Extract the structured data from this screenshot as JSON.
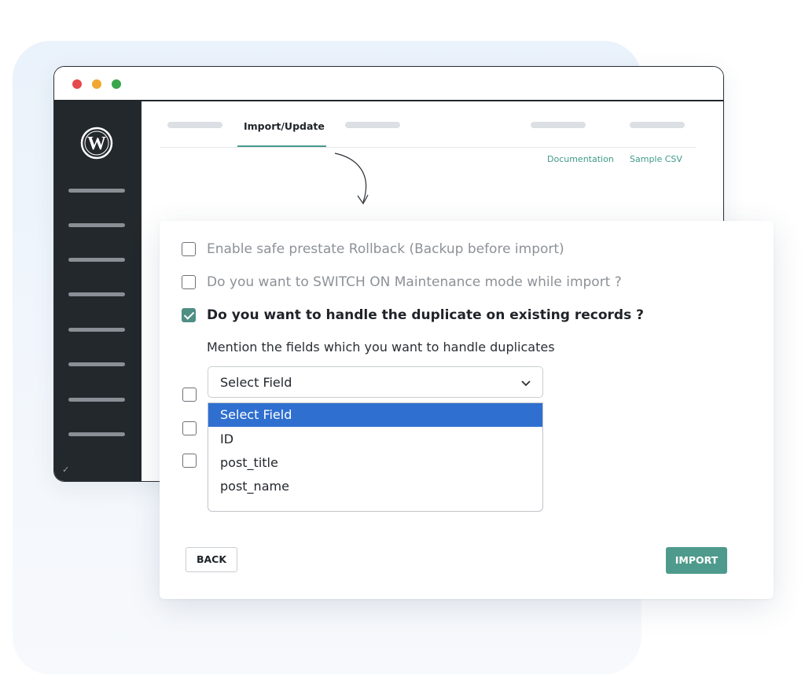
{
  "browser": {
    "top_tabs": {
      "active_label": "Import/Update"
    },
    "links": {
      "documentation": "Documentation",
      "sample_csv": "Sample CSV"
    }
  },
  "dialog": {
    "options": [
      {
        "label": "Enable safe prestate Rollback (Backup before import)",
        "checked": false
      },
      {
        "label": "Do you want to SWITCH ON Maintenance mode while import ?",
        "checked": false
      },
      {
        "label": "Do you want to handle the duplicate on existing records ?",
        "checked": true
      }
    ],
    "mention_text": "Mention the fields which you want to handle duplicates",
    "select": {
      "value": "Select Field",
      "options": [
        "Select Field",
        "ID",
        "post_title",
        "post_name"
      ],
      "highlighted": "Select Field"
    },
    "buttons": {
      "back": "BACK",
      "import": "IMPORT"
    }
  },
  "colors": {
    "accent": "#4e9a8c",
    "dropdown_highlight": "#2f6fd0",
    "sidebar": "#23282d"
  }
}
